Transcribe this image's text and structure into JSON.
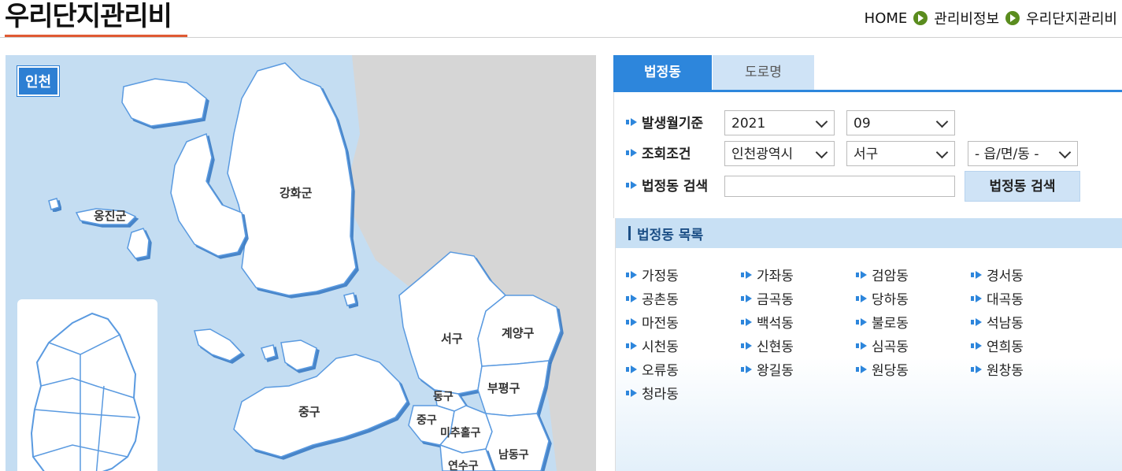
{
  "header": {
    "title": "우리단지관리비",
    "breadcrumb": [
      "HOME",
      "관리비정보",
      "우리단지관리비"
    ]
  },
  "map": {
    "badge": "인천",
    "regions": [
      "강화군",
      "옹진군",
      "서구",
      "계양구",
      "동구",
      "부평구",
      "중구",
      "중구",
      "미추홀구",
      "남동구",
      "연수구"
    ],
    "colors": {
      "sea": "#c4ddf2",
      "land": "#ffffff",
      "other_land": "#d6d6d6",
      "border": "#4a90d9"
    }
  },
  "tabs": [
    {
      "label": "법정동",
      "active": true
    },
    {
      "label": "도로명",
      "active": false
    }
  ],
  "search": {
    "period_label": "발생월기준",
    "year": "2021",
    "month": "09",
    "condition_label": "조회조건",
    "city": "인천광역시",
    "district": "서구",
    "dong": "- 읍/면/동 -",
    "keyword_label": "법정동 검색",
    "keyword_value": "",
    "button_label": "법정동 검색"
  },
  "dong_list": {
    "title": "법정동 목록",
    "items": [
      "가정동",
      "가좌동",
      "검암동",
      "경서동",
      "공촌동",
      "금곡동",
      "당하동",
      "대곡동",
      "마전동",
      "백석동",
      "불로동",
      "석남동",
      "시천동",
      "신현동",
      "심곡동",
      "연희동",
      "오류동",
      "왕길동",
      "원당동",
      "원창동",
      "청라동"
    ]
  }
}
